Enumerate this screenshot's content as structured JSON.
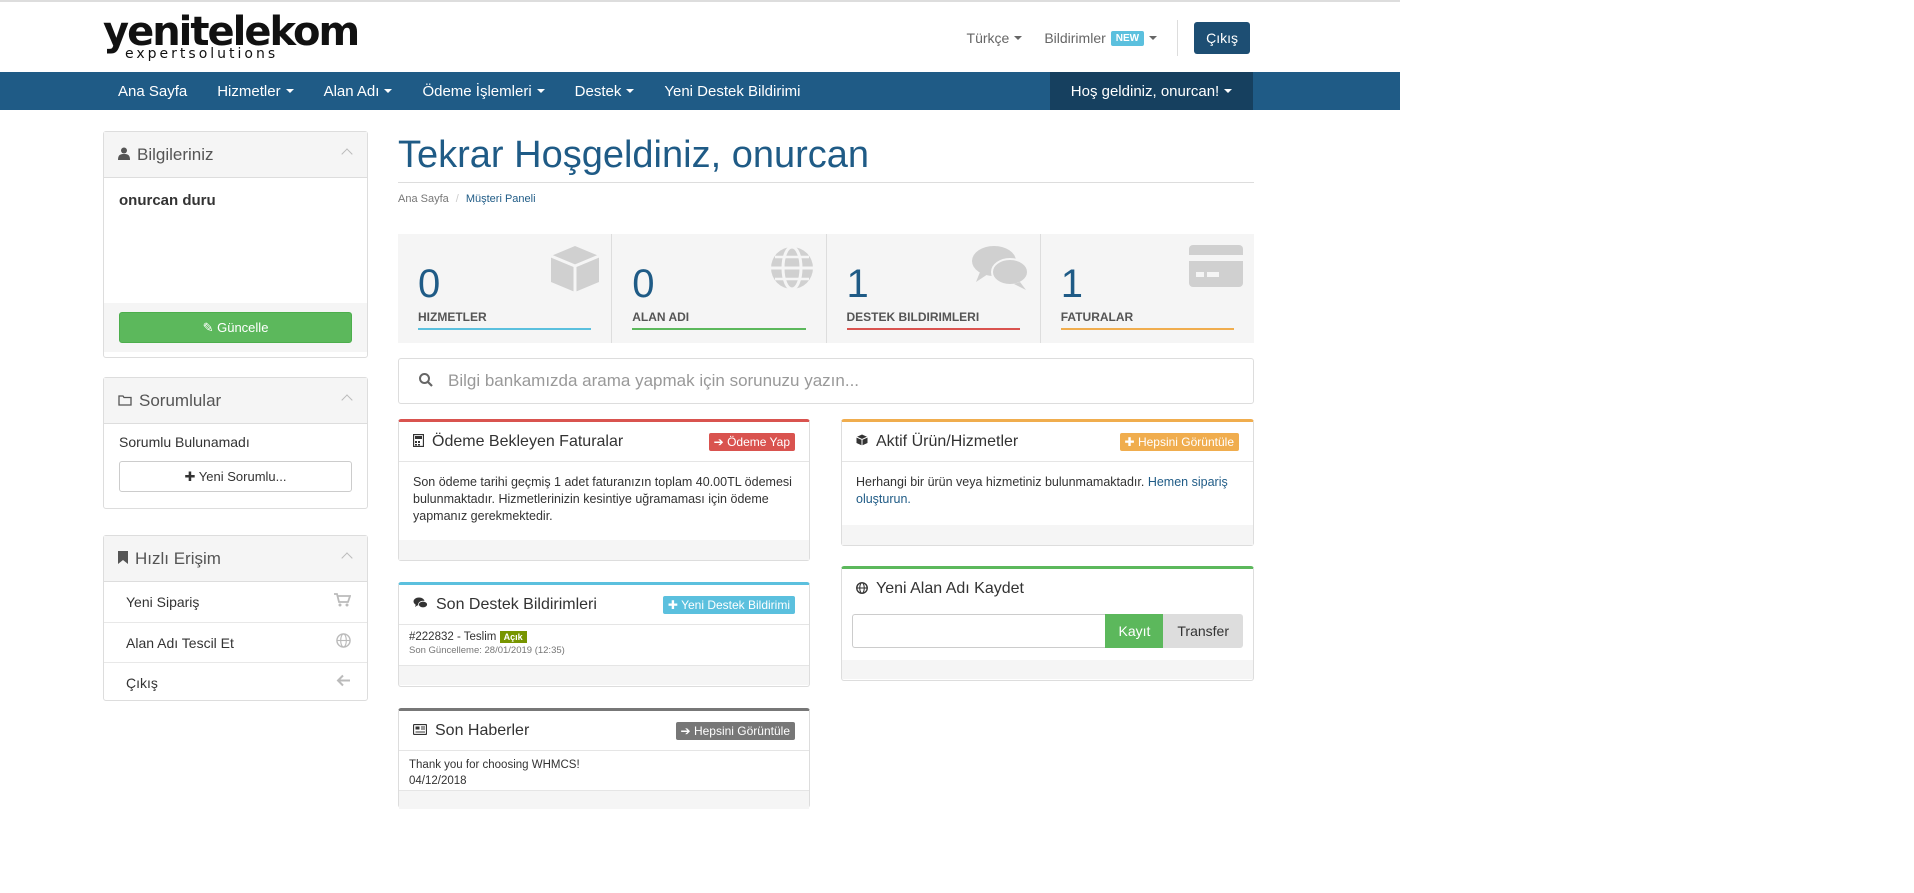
{
  "brand": {
    "name": "yenitelekom",
    "tagline": "expertsolutions"
  },
  "header": {
    "language": "Türkçe",
    "notifications": "Bildirimler",
    "notifications_badge": "NEW",
    "logout": "Çıkış"
  },
  "nav": {
    "items": [
      {
        "label": "Ana Sayfa"
      },
      {
        "label": "Hizmetler"
      },
      {
        "label": "Alan Adı"
      },
      {
        "label": "Ödeme İşlemleri"
      },
      {
        "label": "Destek"
      },
      {
        "label": "Yeni Destek Bildirimi"
      }
    ],
    "welcome": "Hoş geldiniz, onurcan!"
  },
  "sidebar": {
    "info": {
      "title": "Bilgileriniz",
      "name": "onurcan duru",
      "button": "Güncelle"
    },
    "contacts": {
      "title": "Sorumlular",
      "empty": "Sorumlu Bulunamadı",
      "button": "Yeni Sorumlu..."
    },
    "quick": {
      "title": "Hızlı Erişim",
      "items": [
        {
          "label": "Yeni Sipariş",
          "icon": "cart-icon"
        },
        {
          "label": "Alan Adı Tescil Et",
          "icon": "globe-icon"
        },
        {
          "label": "Çıkış",
          "icon": "arrow-left-icon"
        }
      ]
    }
  },
  "main": {
    "title": "Tekrar Hoşgeldiniz, onurcan",
    "breadcrumb": {
      "home": "Ana Sayfa",
      "current": "Müşteri Paneli"
    },
    "stats": [
      {
        "value": "0",
        "label": "HIZMETLER",
        "color": "#5bc0de",
        "icon": "cube-icon"
      },
      {
        "value": "0",
        "label": "ALAN ADI",
        "color": "#5cb85c",
        "icon": "globe-icon"
      },
      {
        "value": "1",
        "label": "DESTEK BILDIRIMLERI",
        "color": "#d9534f",
        "icon": "comments-icon"
      },
      {
        "value": "1",
        "label": "FATURALAR",
        "color": "#f0ad4e",
        "icon": "credit-card-icon"
      }
    ],
    "search_placeholder": "Bilgi bankamızda arama yapmak için sorunuzu yazın...",
    "invoices": {
      "title": "Ödeme Bekleyen Faturalar",
      "button": "Ödeme Yap",
      "text": "Son ödeme tarihi geçmiş 1 adet faturanızın toplam 40.00TL ödemesi bulunmaktadır. Hizmetlerinizin kesintiye uğramaması için ödeme yapmanız gerekmektedir.",
      "color": "#d9534f"
    },
    "services": {
      "title": "Aktif Ürün/Hizmetler",
      "button": "Hepsini Görüntüle",
      "text": "Herhangi bir ürün veya hizmetiniz bulunmamaktadır.",
      "link": "Hemen sipariş oluşturun.",
      "color": "#f0ad4e"
    },
    "tickets": {
      "title": "Son Destek Bildirimleri",
      "button": "Yeni Destek Bildirimi",
      "ticket": "#222832 - Teslim",
      "status": "Açık",
      "updated": "Son Güncelleme: 28/01/2019 (12:35)",
      "color": "#5bc0de"
    },
    "domain": {
      "title": "Yeni Alan Adı Kaydet",
      "register": "Kayıt",
      "transfer": "Transfer",
      "color": "#5cb85c"
    },
    "news": {
      "title": "Son Haberler",
      "button": "Hepsini Görüntüle",
      "item": "Thank you for choosing WHMCS!",
      "date": "04/12/2018",
      "color": "#777777"
    }
  }
}
